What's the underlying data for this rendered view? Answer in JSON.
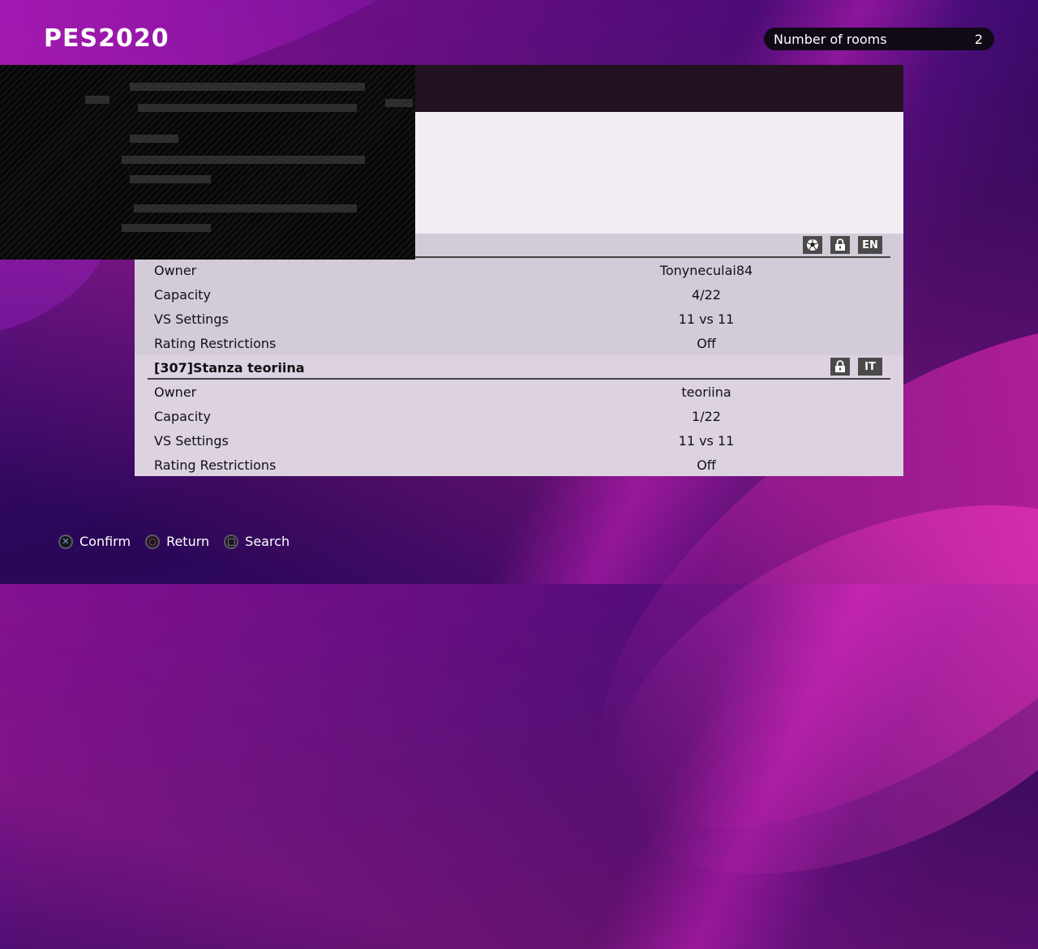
{
  "app": {
    "logo_text": "PES2020"
  },
  "header": {
    "rooms_label": "Number of rooms",
    "rooms_count": "2"
  },
  "rooms": [
    {
      "title": "",
      "tag_icons": [
        "ball-icon",
        "lock-icon"
      ],
      "language": "EN",
      "details": [
        {
          "label": "Owner",
          "value": "Tonyneculai84"
        },
        {
          "label": "Capacity",
          "value": "4/22"
        },
        {
          "label": "VS Settings",
          "value": "11 vs 11"
        },
        {
          "label": "Rating Restrictions",
          "value": "Off"
        }
      ]
    },
    {
      "title": "[307]Stanza teoriina",
      "tag_icons": [
        "lock-icon"
      ],
      "language": "IT",
      "details": [
        {
          "label": "Owner",
          "value": "teoriina"
        },
        {
          "label": "Capacity",
          "value": "1/22"
        },
        {
          "label": "VS Settings",
          "value": "11 vs 11"
        },
        {
          "label": "Rating Restrictions",
          "value": "Off"
        }
      ]
    }
  ],
  "controls": {
    "confirm_label": "Confirm",
    "return_label": "Return",
    "search_label": "Search"
  },
  "colors": {
    "accent_magenta": "#c41ebe",
    "panel_bg": "#d4cbd9",
    "pill_bg": "#0f0a16"
  }
}
